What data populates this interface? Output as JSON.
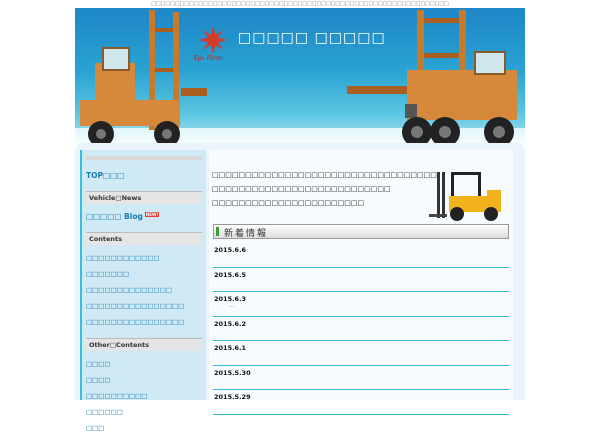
{
  "top_bar": {
    "text": "□□□□□□□□□□□□□□□□□□□□□□□□□□□□□□□□□□□□□□□□□□□□□□□□□□□□□□□□□□□□□□□"
  },
  "header": {
    "logo_text": "Tyo Firm",
    "site_title": "□□□□□ □□□□□"
  },
  "sidebar": {
    "top_link": "TOP□□□",
    "vehicle_news_heading": "Vehicle□News",
    "blog_link": "□□□□□ Blog",
    "new_badge": "NEW!",
    "contents_heading": "Contents",
    "contents_items": [
      "□□□□□□□□□□□□",
      "□□□□□□□",
      "□□□□□□□□□□□□□□",
      "□□□□□□□□□□□□□□□□",
      "□□□□□□□□□□□□□□□□"
    ],
    "other_heading": "Other□Contents",
    "other_items": [
      "□□□□",
      "□□□□",
      "□□□□□□□□□□",
      "□□□□□□",
      "□□□"
    ]
  },
  "main": {
    "intro_lines": [
      "□□□□□□□□□□□□□□□□□□□□□□□□□□□□□□□□□□",
      "□□□□□□□□□□□□□□□□□□□□□□□□□□□",
      "□□□□□□□□□□□□□□□□□□□□□□□"
    ],
    "news_title": "新着情報",
    "news": [
      {
        "date": "2015.6.6",
        "snippet": ""
      },
      {
        "date": "2015.6.5",
        "snippet": ""
      },
      {
        "date": "2015.6.3",
        "snippet": "…"
      },
      {
        "date": "2015.6.2",
        "snippet": ""
      },
      {
        "date": "2015.6.1",
        "snippet": ""
      },
      {
        "date": "2015.5.30",
        "snippet": ""
      },
      {
        "date": "2015.5.29",
        "snippet": ""
      }
    ]
  },
  "colors": {
    "accent": "#1a7bb3",
    "banner_top": "#1d86c6",
    "divider": "#35b7d9",
    "forklift": "#d6893a"
  }
}
